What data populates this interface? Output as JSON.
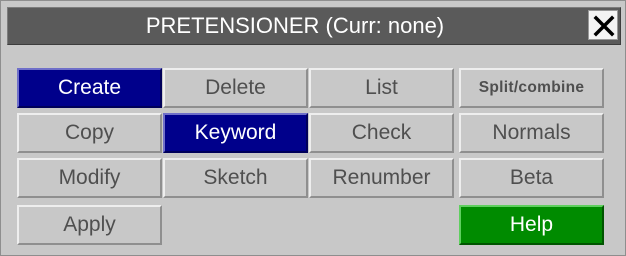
{
  "window": {
    "title": "PRETENSIONER (Curr: none)",
    "close_icon": "close-icon"
  },
  "buttons": {
    "create": "Create",
    "delete": "Delete",
    "list": "List",
    "split_combine": "Split/combine",
    "copy": "Copy",
    "keyword": "Keyword",
    "check": "Check",
    "normals": "Normals",
    "modify": "Modify",
    "sketch": "Sketch",
    "renumber": "Renumber",
    "beta": "Beta",
    "apply": "Apply",
    "help": "Help"
  },
  "state": {
    "active_buttons": [
      "Create",
      "Keyword"
    ]
  },
  "colors": {
    "panel": "#c8c8c8",
    "titlebar": "#5a5a5a",
    "active": "#00008b",
    "help": "#008b00",
    "text": "#4f4f4f"
  }
}
